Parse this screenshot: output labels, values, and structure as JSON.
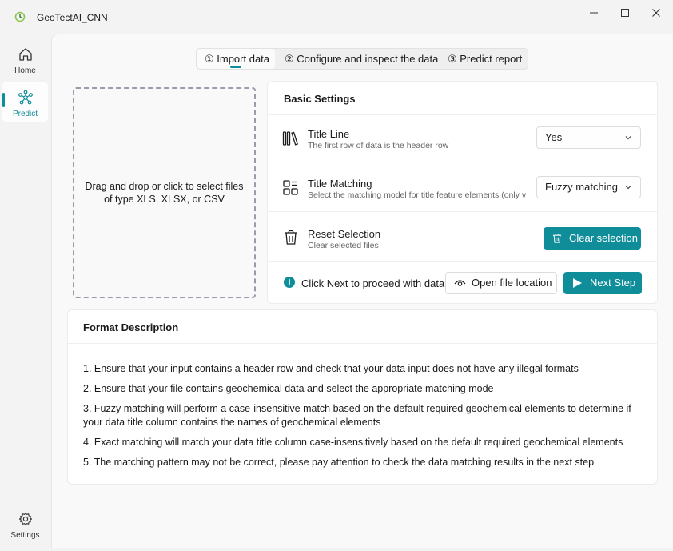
{
  "app": {
    "title": "GeoTectAI_CNN"
  },
  "sidebar": {
    "items": [
      {
        "label": "Home",
        "icon": "home-icon"
      },
      {
        "label": "Predict",
        "icon": "molecule-icon"
      }
    ],
    "settings_label": "Settings"
  },
  "steps": [
    {
      "label": "① Import data"
    },
    {
      "label": "② Configure and inspect the data"
    },
    {
      "label": "③ Predict report"
    }
  ],
  "dropzone": {
    "line1": "Drag and drop or click to select files",
    "line2": "of type XLS, XLSX, or CSV"
  },
  "basic_settings": {
    "title": "Basic Settings",
    "title_line": {
      "title": "Title Line",
      "subtitle": "The first row of data is the header row",
      "value": "Yes"
    },
    "title_matching": {
      "title": "Title Matching",
      "subtitle": "Select the matching model for title feature elements (only v",
      "value": "Fuzzy matching"
    },
    "reset": {
      "title": "Reset Selection",
      "subtitle": "Clear selected files",
      "button": "Clear selection"
    },
    "footer": {
      "info": "Click Next to proceed with data",
      "open_location": "Open file location",
      "next": "Next Step"
    }
  },
  "format": {
    "title": "Format Description",
    "items": [
      "1. Ensure that your input contains a header row and check that your data input does not have any illegal formats",
      "2. Ensure that your file contains geochemical data and select the appropriate matching mode",
      "3. Fuzzy matching will perform a case-insensitive match based on the default required geochemical elements to determine if your data title column contains the names of geochemical elements",
      "4. Exact matching will match your data title column case-insensitively based on the default required geochemical elements",
      "5. The matching pattern may not be correct, please pay attention to check the data matching results in the next step"
    ]
  },
  "colors": {
    "accent": "#0f8e9a",
    "background": "#f3f3f3",
    "card": "#ffffff"
  }
}
